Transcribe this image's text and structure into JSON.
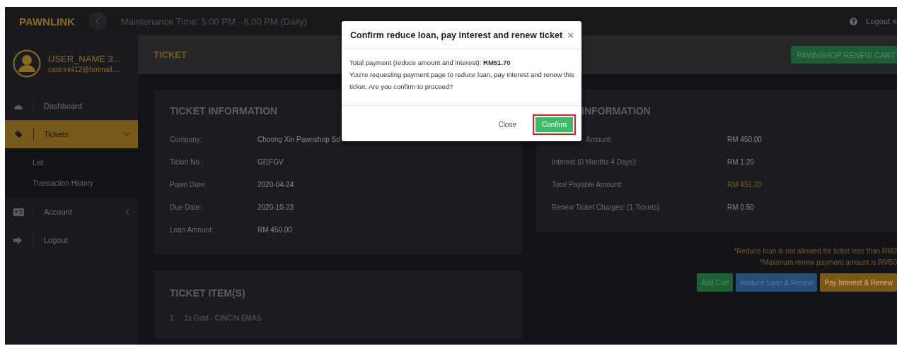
{
  "top_bar": {
    "logo": "PAWNLINK",
    "maintenance": "Maintenance Time: 5:00 PM - 6:00 PM (Daily)",
    "logout": "Logout"
  },
  "user": {
    "name": "USER_NAME 3...",
    "email": "castrini412@hotmail...."
  },
  "sidebar": {
    "items": [
      {
        "label": "Dashboard",
        "kind": "link",
        "selected": false
      },
      {
        "label": "Tickets",
        "kind": "group",
        "selected": true,
        "expanded": true,
        "children": [
          {
            "label": "List"
          },
          {
            "label": "Transaction History"
          }
        ]
      },
      {
        "label": "Account",
        "kind": "group",
        "selected": false,
        "expanded": false
      },
      {
        "label": "Logout",
        "kind": "link",
        "selected": false
      }
    ]
  },
  "page_header": {
    "title": "TICKET",
    "cart_button": "PAWNSHOP RENEW CART"
  },
  "ticket_info": {
    "title": "TICKET INFORMATION",
    "rows": [
      {
        "label": "Company:",
        "value": "Choong Xin Pawnshop Sd"
      },
      {
        "label": "Ticket No.:",
        "value": "GI1FGV"
      },
      {
        "label": "Pawn Date:",
        "value": "2020-04-24"
      },
      {
        "label": "Due Date:",
        "value": "2020-10-23"
      },
      {
        "label": "Loan Amount:",
        "value": "RM 450.00"
      }
    ]
  },
  "ticket_items": {
    "title": "TICKET ITEM(S)",
    "items": [
      {
        "number": "1.",
        "text": "1x Gold - CINCIN EMAS"
      }
    ]
  },
  "payment_info": {
    "title": "INFORMATION",
    "rows": [
      {
        "label": "Amount:",
        "value": "RM 450.00",
        "highlight": false
      },
      {
        "label": "Interest (0 Months 4 Days):",
        "value": "RM 1.20",
        "highlight": false
      },
      {
        "label": "Total Payable Amount:",
        "value": "RM 451.20",
        "highlight": true
      },
      {
        "label": "Renew Ticket Charges: (1 Tickets)",
        "value": "RM 0.50",
        "highlight": false
      }
    ]
  },
  "notes": [
    "*Reduce loan is not allowed for ticket less than RM2",
    "*Maximum renew payment amount is RM50"
  ],
  "actions": [
    {
      "label": "Add Cart",
      "kind": "add"
    },
    {
      "label": "Reduce Loan & Renew",
      "kind": "reduce"
    },
    {
      "label": "Pay Interest & Renew",
      "kind": "pay"
    }
  ],
  "dialog": {
    "title": "Confirm reduce loan, pay interest and renew ticket",
    "close": "×",
    "message_lines": [
      "Total payment (reduce amount and interest): **RM51.70**",
      "You're requesting payment page to reduce loan, pay interest and renew this ticket. Are you confirm to proceed?"
    ],
    "buttons": [
      {
        "label": "Close",
        "kind": "link",
        "highlighted": false
      },
      {
        "label": "Confirm",
        "kind": "primary",
        "highlighted": true
      }
    ]
  }
}
